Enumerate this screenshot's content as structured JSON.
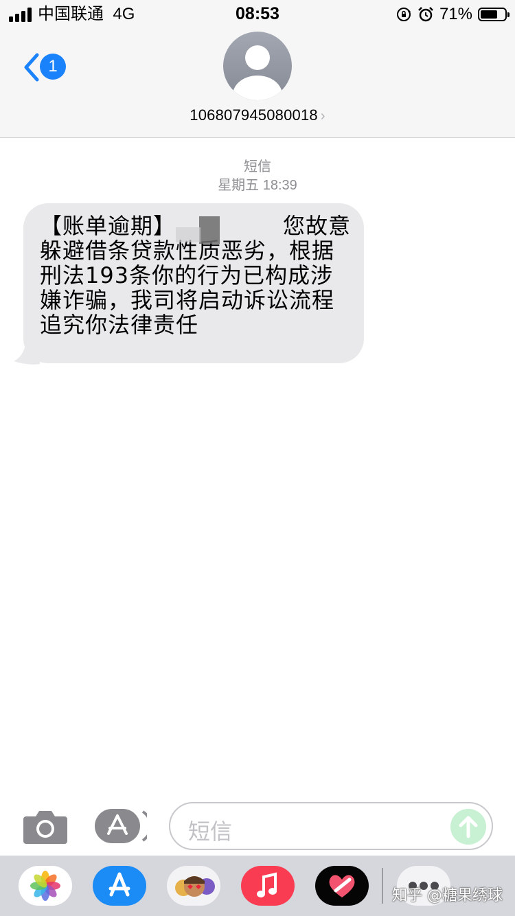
{
  "status_bar": {
    "carrier": "中国联通",
    "network": "4G",
    "time": "08:53",
    "battery_percent": "71%",
    "battery_level": 0.71,
    "icons": [
      "signal-icon",
      "rotation-lock-icon",
      "alarm-icon",
      "battery-icon"
    ]
  },
  "header": {
    "back_badge_count": "1",
    "contact_number": "106807945080018",
    "chevron": "›"
  },
  "thread": {
    "service_label": "短信",
    "timestamp": "星期五 18:39",
    "message": {
      "line1_prefix": "【账单逾期】",
      "line1_suffix": "您故意",
      "line2": "躲避借条贷款性质恶劣，根据",
      "line3": "刑法193条你的行为已构成涉",
      "line4": "嫌诈骗，我司将启动诉讼流程",
      "line5": "追究你法律责任"
    }
  },
  "input_bar": {
    "placeholder": "短信"
  },
  "app_drawer": {
    "apps": [
      "photos-app-icon",
      "app-store-app-icon",
      "memoji-app-icon",
      "music-app-icon",
      "digital-touch-app-icon",
      "more-apps-icon"
    ],
    "watermark": "知乎 @糖果绣球"
  },
  "colors": {
    "accent": "#1a82fb",
    "bubble_incoming": "#e9e9eb",
    "bar_background": "#f6f6f6",
    "drawer_background": "#d5d7dc",
    "send_button": "#c8f0d3"
  }
}
